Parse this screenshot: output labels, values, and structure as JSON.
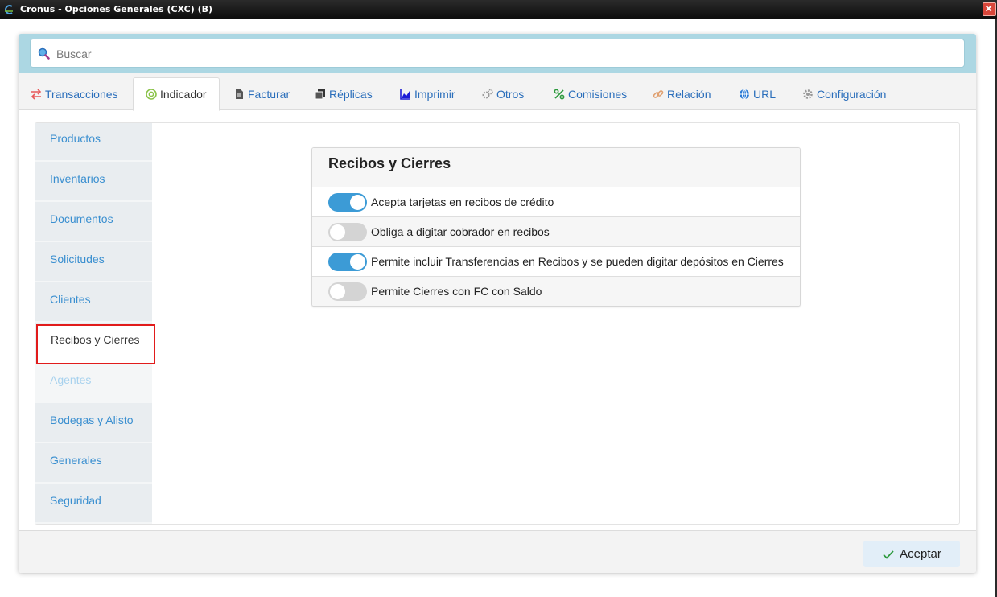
{
  "window": {
    "title": "Cronus - Opciones Generales (CXC) (B)"
  },
  "search": {
    "placeholder": "Buscar"
  },
  "tabs": [
    {
      "label": "Transacciones",
      "icon": "arrows-exchange-icon"
    },
    {
      "label": "Indicador",
      "icon": "target-icon",
      "active": true
    },
    {
      "label": "Facturar",
      "icon": "document-icon"
    },
    {
      "label": "Réplicas",
      "icon": "copy-icon"
    },
    {
      "label": "Imprimir",
      "icon": "area-chart-icon"
    },
    {
      "label": "Otros",
      "icon": "gears-icon"
    },
    {
      "label": "Comisiones",
      "icon": "percent-icon"
    },
    {
      "label": "Relación",
      "icon": "link-icon"
    },
    {
      "label": "URL",
      "icon": "globe-icon"
    },
    {
      "label": "Configuración",
      "icon": "gear-icon"
    }
  ],
  "sidebar": {
    "items": [
      {
        "label": "Productos"
      },
      {
        "label": "Inventarios"
      },
      {
        "label": "Documentos"
      },
      {
        "label": "Solicitudes"
      },
      {
        "label": "Clientes"
      },
      {
        "label": "Recibos y Cierres",
        "active": true
      },
      {
        "label": "Agentes",
        "disabled": true
      },
      {
        "label": "Bodegas y Alisto"
      },
      {
        "label": "Generales"
      },
      {
        "label": "Seguridad"
      }
    ]
  },
  "card": {
    "title": "Recibos y Cierres",
    "options": [
      {
        "label": "Acepta tarjetas en recibos de crédito",
        "enabled": true
      },
      {
        "label": "Obliga a digitar cobrador en recibos",
        "enabled": false
      },
      {
        "label": "Permite incluir Transferencias en Recibos y se pueden digitar depósitos en Cierres",
        "enabled": true
      },
      {
        "label": "Permite Cierres con FC con Saldo",
        "enabled": false
      }
    ]
  },
  "footer": {
    "accept_label": "Aceptar"
  },
  "colors": {
    "accent": "#3c9bd6",
    "link": "#2a6ebb",
    "highlight": "#e11b1b",
    "search_band": "#acd7e3"
  }
}
